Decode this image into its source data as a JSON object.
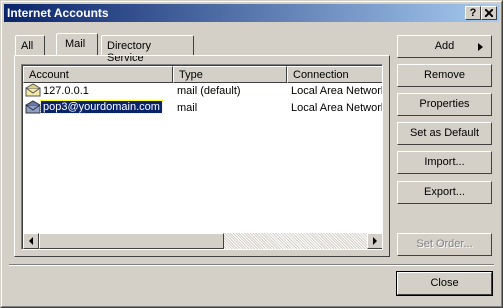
{
  "window": {
    "title": "Internet Accounts",
    "help_label": "?",
    "close_label": "X"
  },
  "tabs": [
    {
      "label": "All"
    },
    {
      "label": "Mail"
    },
    {
      "label": "Directory Service"
    }
  ],
  "list": {
    "columns": [
      "Account",
      "Type",
      "Connection"
    ],
    "rows": [
      {
        "account": "127.0.0.1",
        "type": "mail (default)",
        "connection": "Local Area Network",
        "icon": "mail-account-icon"
      },
      {
        "account": "pop3@yourdomain.com",
        "type": "mail",
        "connection": "Local Area Network",
        "icon": "mail-account-icon"
      }
    ]
  },
  "buttons": {
    "add": "Add",
    "remove": "Remove",
    "properties": "Properties",
    "set_default": "Set as Default",
    "import": "Import...",
    "export": "Export...",
    "set_order": "Set Order...",
    "close": "Close"
  },
  "colors": {
    "titlebar": "#0a246a",
    "selection": "#0a246a",
    "face": "#d4d0c8"
  }
}
